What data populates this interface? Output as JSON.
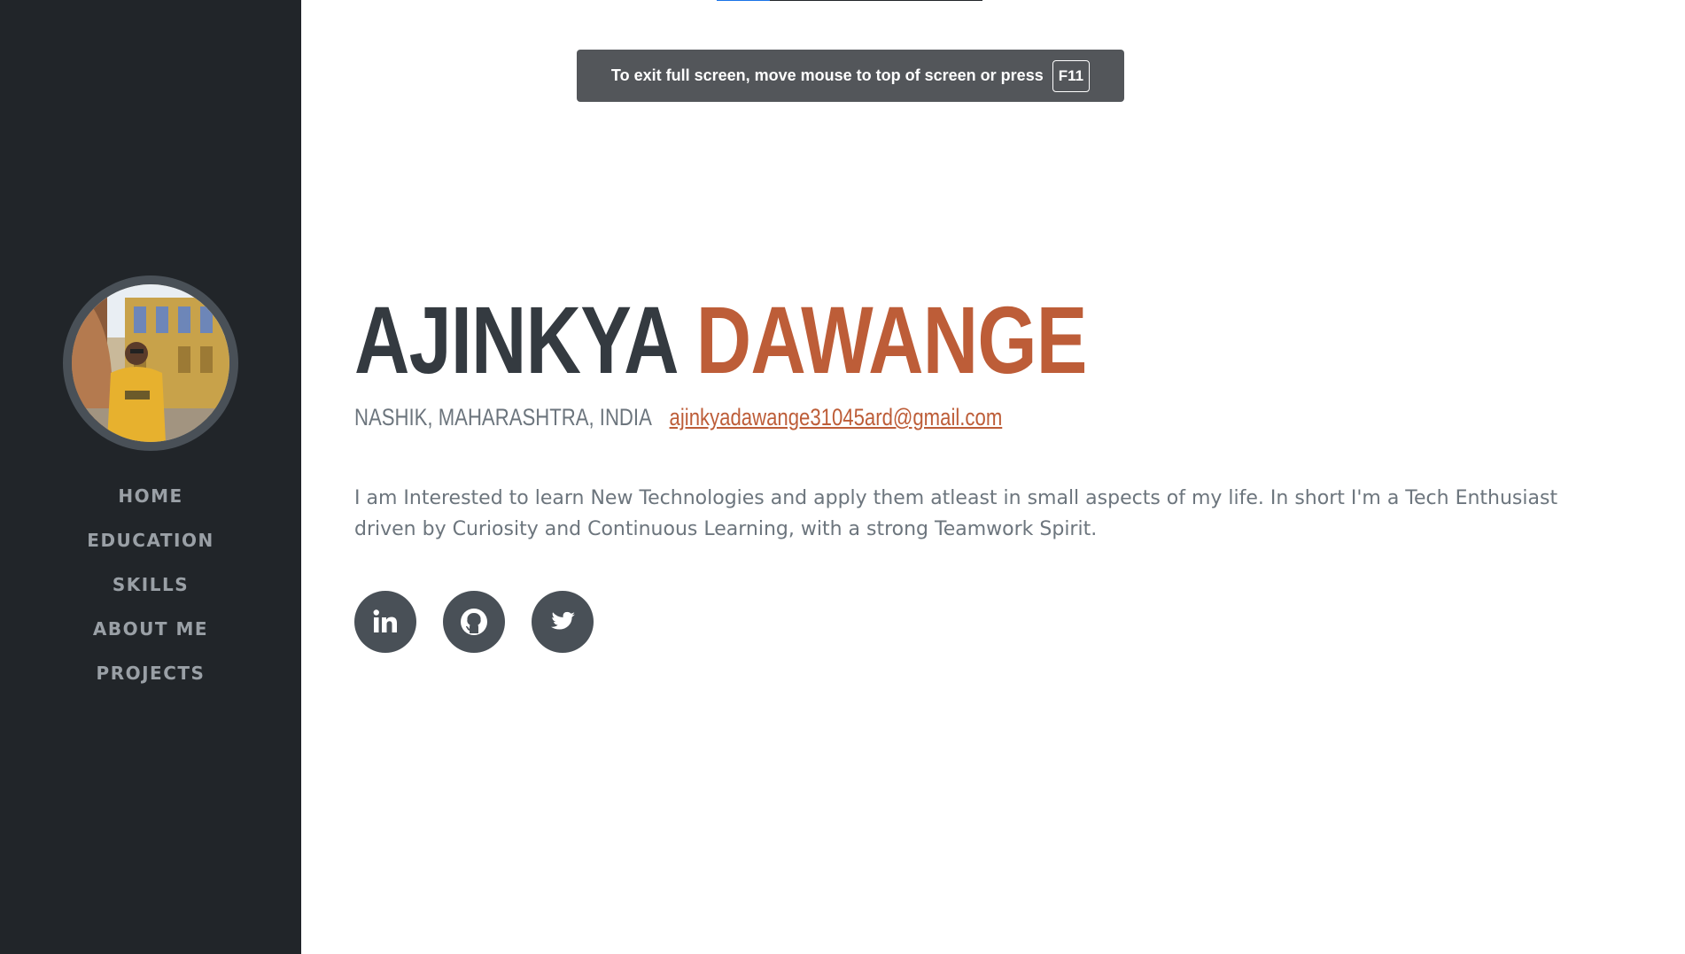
{
  "toast": {
    "message": "To exit full screen, move mouse to top of screen or press",
    "key": "F11"
  },
  "sidebar": {
    "avatar_alt": "profile photo",
    "nav": [
      {
        "label": "HOME"
      },
      {
        "label": "EDUCATION"
      },
      {
        "label": "SKILLS"
      },
      {
        "label": "ABOUT ME"
      },
      {
        "label": "PROJECTS"
      }
    ]
  },
  "profile": {
    "first_name": "AJINKYA",
    "last_name": "DAWANGE",
    "location": "NASHIK, MAHARASHTRA, INDIA",
    "email": "ajinkyadawange31045ard@gmail.com",
    "bio": "I am Interested to learn New Technologies and apply them atleast in small aspects of my life. In short I'm a Tech Enthusiast driven by Curiosity and Continuous Learning, with a strong Teamwork Spirit."
  },
  "social": [
    {
      "icon": "linkedin-icon"
    },
    {
      "icon": "github-icon"
    },
    {
      "icon": "twitter-icon"
    }
  ],
  "colors": {
    "sidebar_bg": "#212529",
    "accent": "#bd5d38",
    "heading": "#343a40",
    "muted": "#6c757d",
    "social_bg": "#495057"
  }
}
